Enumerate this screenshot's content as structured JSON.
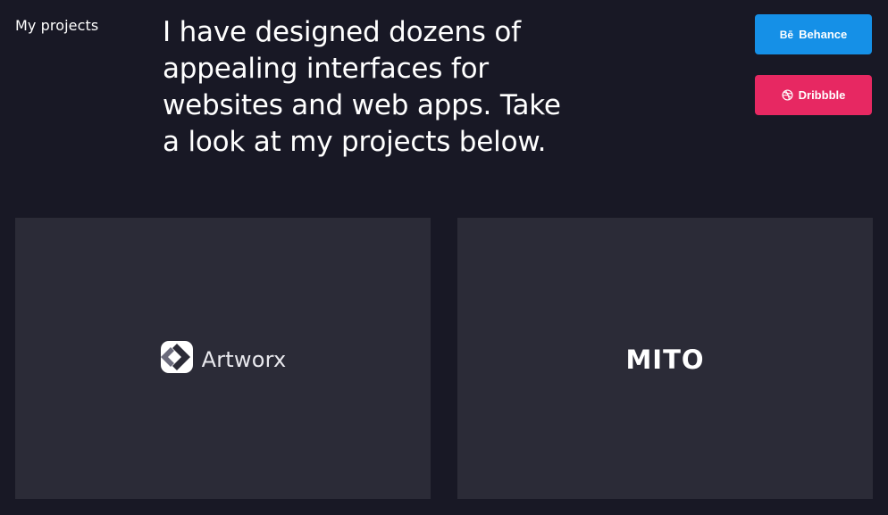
{
  "section": {
    "label": "My projects"
  },
  "intro": {
    "text": "I have designed dozens of appealing interfaces for websites and web apps. Take a look at my projects below."
  },
  "links": {
    "behance": {
      "icon_text": "Bē",
      "label": "Behance",
      "color": "#1590e7",
      "icon": "behance-icon"
    },
    "dribbble": {
      "label": "Dribbble",
      "color": "#e72862",
      "icon": "dribbble-icon"
    }
  },
  "projects": [
    {
      "name": "Artworx",
      "logo": "artworx-logo-icon"
    },
    {
      "name": "MITO"
    }
  ],
  "colors": {
    "background": "#181825",
    "card": "#2b2b37",
    "text": "#ffffff"
  }
}
